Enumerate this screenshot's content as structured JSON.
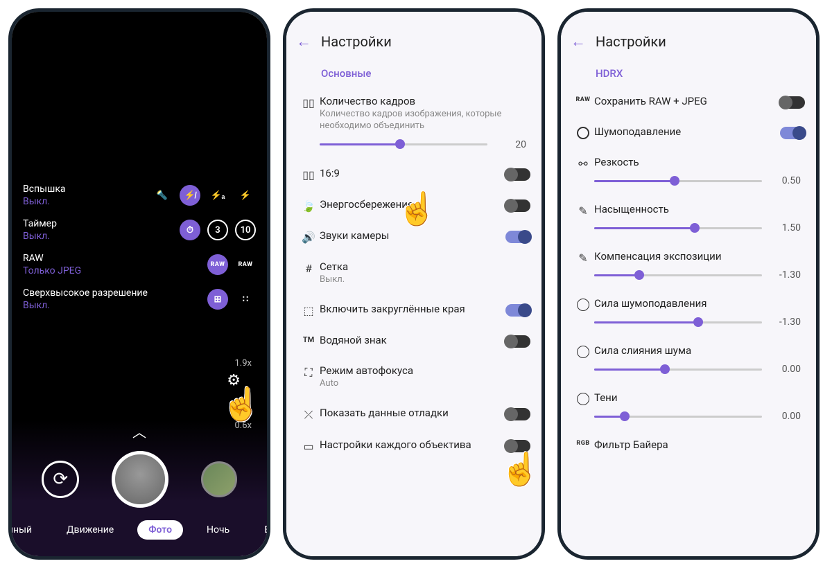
{
  "phone1": {
    "quick": {
      "flash_label": "Вспышка",
      "flash_value": "Выкл.",
      "timer_label": "Таймер",
      "timer_value": "Выкл.",
      "raw_label": "RAW",
      "raw_value": "Только JPEG",
      "superres_label": "Сверхвысокое разрешение",
      "superres_value": "Выкл."
    },
    "flash_icons": [
      "torch",
      "off",
      "auto",
      "on"
    ],
    "timer_icons": [
      "off",
      "3",
      "10"
    ],
    "zoom_upper": "1.9x",
    "zoom_lower": "0.6x",
    "modes": {
      "left_cut": "ечный",
      "motion": "Движение",
      "photo": "Фото",
      "night": "Ночь",
      "right_cut": "Ви"
    }
  },
  "phone2": {
    "title": "Настройки",
    "section": "Основные",
    "rows": {
      "frames_title": "Количество кадров",
      "frames_desc": "Количество кадров изображения, которые необходимо объединить",
      "frames_value": "20",
      "aspect": "16:9",
      "powersave": "Энергосбережение",
      "sounds": "Звуки камеры",
      "grid_title": "Сетка",
      "grid_value": "Выкл.",
      "rounded": "Включить закруглённые края",
      "watermark": "Водяной знак",
      "af_title": "Режим автофокуса",
      "af_value": "Auto",
      "debug": "Показать данные отладки",
      "perlens": "Настройки каждого объектива"
    }
  },
  "phone3": {
    "title": "Настройки",
    "section": "HDRX",
    "rows": {
      "rawjpeg": "Сохранить RAW + JPEG",
      "denoise": "Шумоподавление",
      "sharp": "Резкость",
      "sharp_val": "0.50",
      "sat": "Насыщенность",
      "sat_val": "1.50",
      "expcomp": "Компенсация экспозиции",
      "expcomp_val": "-1.30",
      "dnstrength": "Сила шумоподавления",
      "dnstrength_val": "-1.30",
      "mergestrength": "Сила слияния шума",
      "mergestrength_val": "0.00",
      "shadows": "Тени",
      "shadows_val": "0.00",
      "bayer": "Фильтр Байера"
    }
  }
}
